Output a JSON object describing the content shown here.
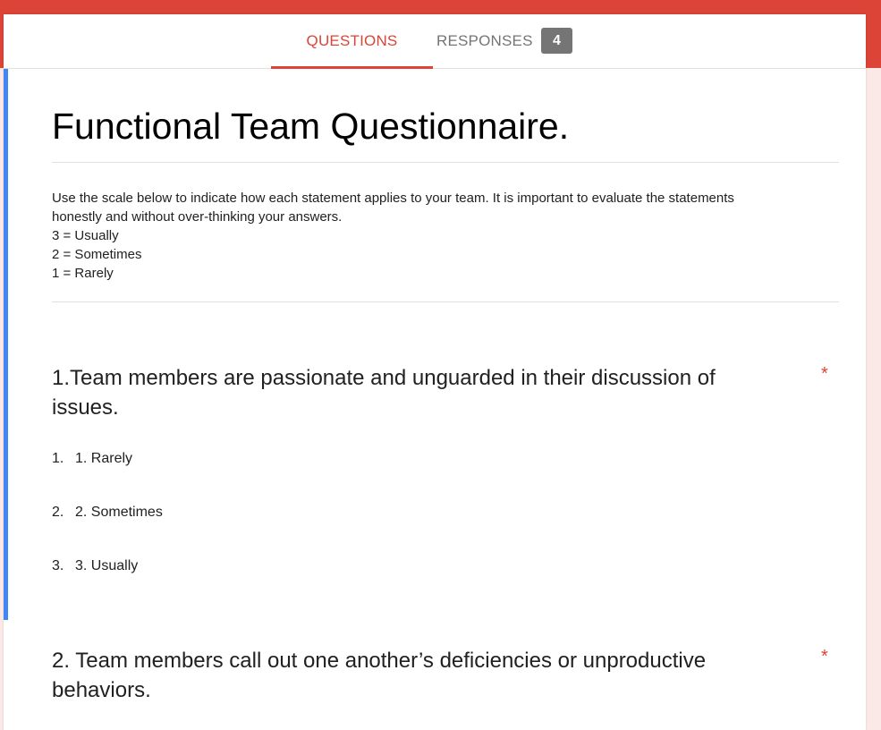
{
  "tabs": {
    "questions_label": "QUESTIONS",
    "responses_label": "RESPONSES",
    "responses_count": "4"
  },
  "form": {
    "title": "Functional Team Questionnaire.",
    "description_lines": [
      " Use the scale below to indicate how each statement applies to your team. It is important to evaluate the statements",
      "honestly and without over-thinking your answers.",
      "3 = Usually",
      "2 = Sometimes",
      "1 = Rarely"
    ]
  },
  "questions": [
    {
      "title": "1.Team members are passionate and unguarded in their discussion of issues.",
      "required_mark": "*",
      "options": [
        {
          "number": "1.",
          "label": "1. Rarely"
        },
        {
          "number": "2.",
          "label": "2. Sometimes"
        },
        {
          "number": "3.",
          "label": "3. Usually"
        }
      ]
    },
    {
      "title": "2. Team members call out one another’s deficiencies or unproductive behaviors.",
      "required_mark": "*"
    }
  ],
  "colors": {
    "brand_red": "#db4437",
    "accent_blue": "#4285f4",
    "badge_gray": "#757575"
  }
}
